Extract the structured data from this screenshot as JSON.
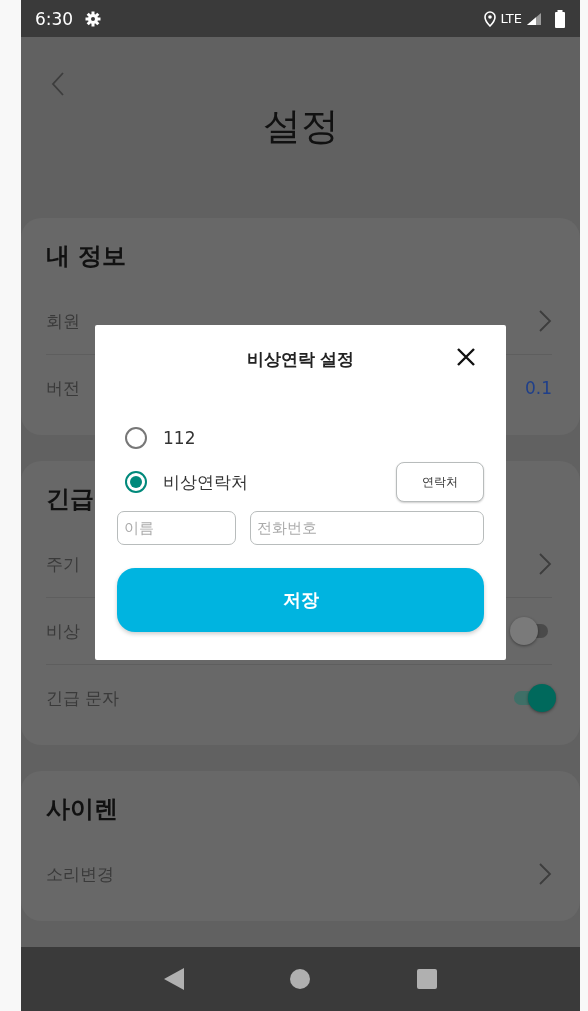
{
  "status_bar": {
    "time": "6:30",
    "network": "LTE"
  },
  "header": {
    "title": "설정"
  },
  "sections": [
    {
      "title": "내 정보",
      "items": [
        {
          "kind": "link",
          "label": "회원"
        },
        {
          "kind": "value",
          "label": "버전",
          "value": "0.1"
        }
      ]
    },
    {
      "title": "긴급",
      "items": [
        {
          "kind": "link",
          "label": "주기"
        },
        {
          "kind": "toggle",
          "label": "비상",
          "on": false
        },
        {
          "kind": "toggle",
          "label": "긴급 문자",
          "on": true
        }
      ]
    },
    {
      "title": "사이렌",
      "items": [
        {
          "kind": "link",
          "label": "소리변경"
        }
      ]
    }
  ],
  "dialog": {
    "title": "비상연락 설정",
    "options": [
      {
        "label": "112",
        "selected": false
      },
      {
        "label": "비상연락처",
        "selected": true
      }
    ],
    "contacts_button": "연락처",
    "name_field": {
      "placeholder": "이름"
    },
    "phone_field": {
      "placeholder": "전화번호"
    },
    "save_button": "저장"
  }
}
